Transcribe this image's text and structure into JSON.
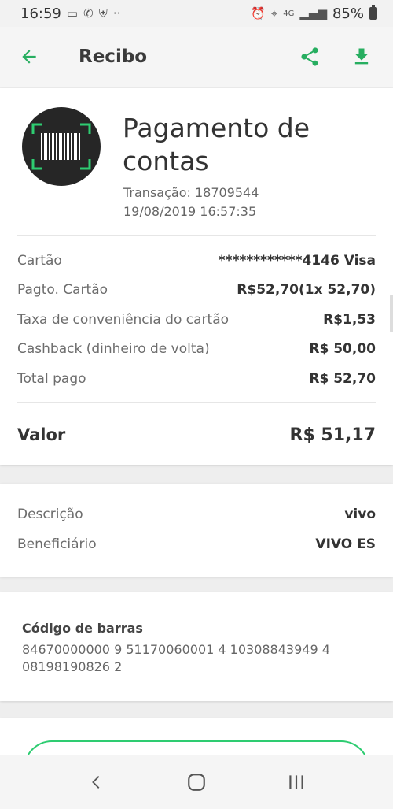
{
  "status_bar": {
    "time": "16:59",
    "battery": "85%",
    "net_badge": "4G"
  },
  "app_bar": {
    "title": "Recibo",
    "accent_color": "#27ae60"
  },
  "receipt": {
    "heading": "Pagamento de contas",
    "transaction": "Transação: 18709544",
    "datetime": "19/08/2019 16:57:35",
    "details": [
      {
        "label": "Cartão",
        "value": "************4146 Visa"
      },
      {
        "label": "Pagto. Cartão",
        "value": "R$52,70(1x 52,70)"
      },
      {
        "label": "Taxa de conveniência do cartão",
        "value": "R$1,53"
      },
      {
        "label": "Cashback (dinheiro de volta)",
        "value": "R$ 50,00"
      },
      {
        "label": "Total pago",
        "value": "R$ 52,70"
      }
    ],
    "total_label": "Valor",
    "total_value": "R$ 51,17"
  },
  "description": {
    "rows": [
      {
        "label": "Descrição",
        "value": "vivo"
      },
      {
        "label": "Beneficiário",
        "value": "VIVO ES"
      }
    ]
  },
  "barcode": {
    "title": "Código de barras",
    "code": "84670000000 9 51170060001 4 10308843949 4 08198190826 2"
  },
  "icons": {
    "back": "arrow-left-icon",
    "share": "share-icon",
    "download": "download-icon",
    "logo": "barcode-icon"
  }
}
